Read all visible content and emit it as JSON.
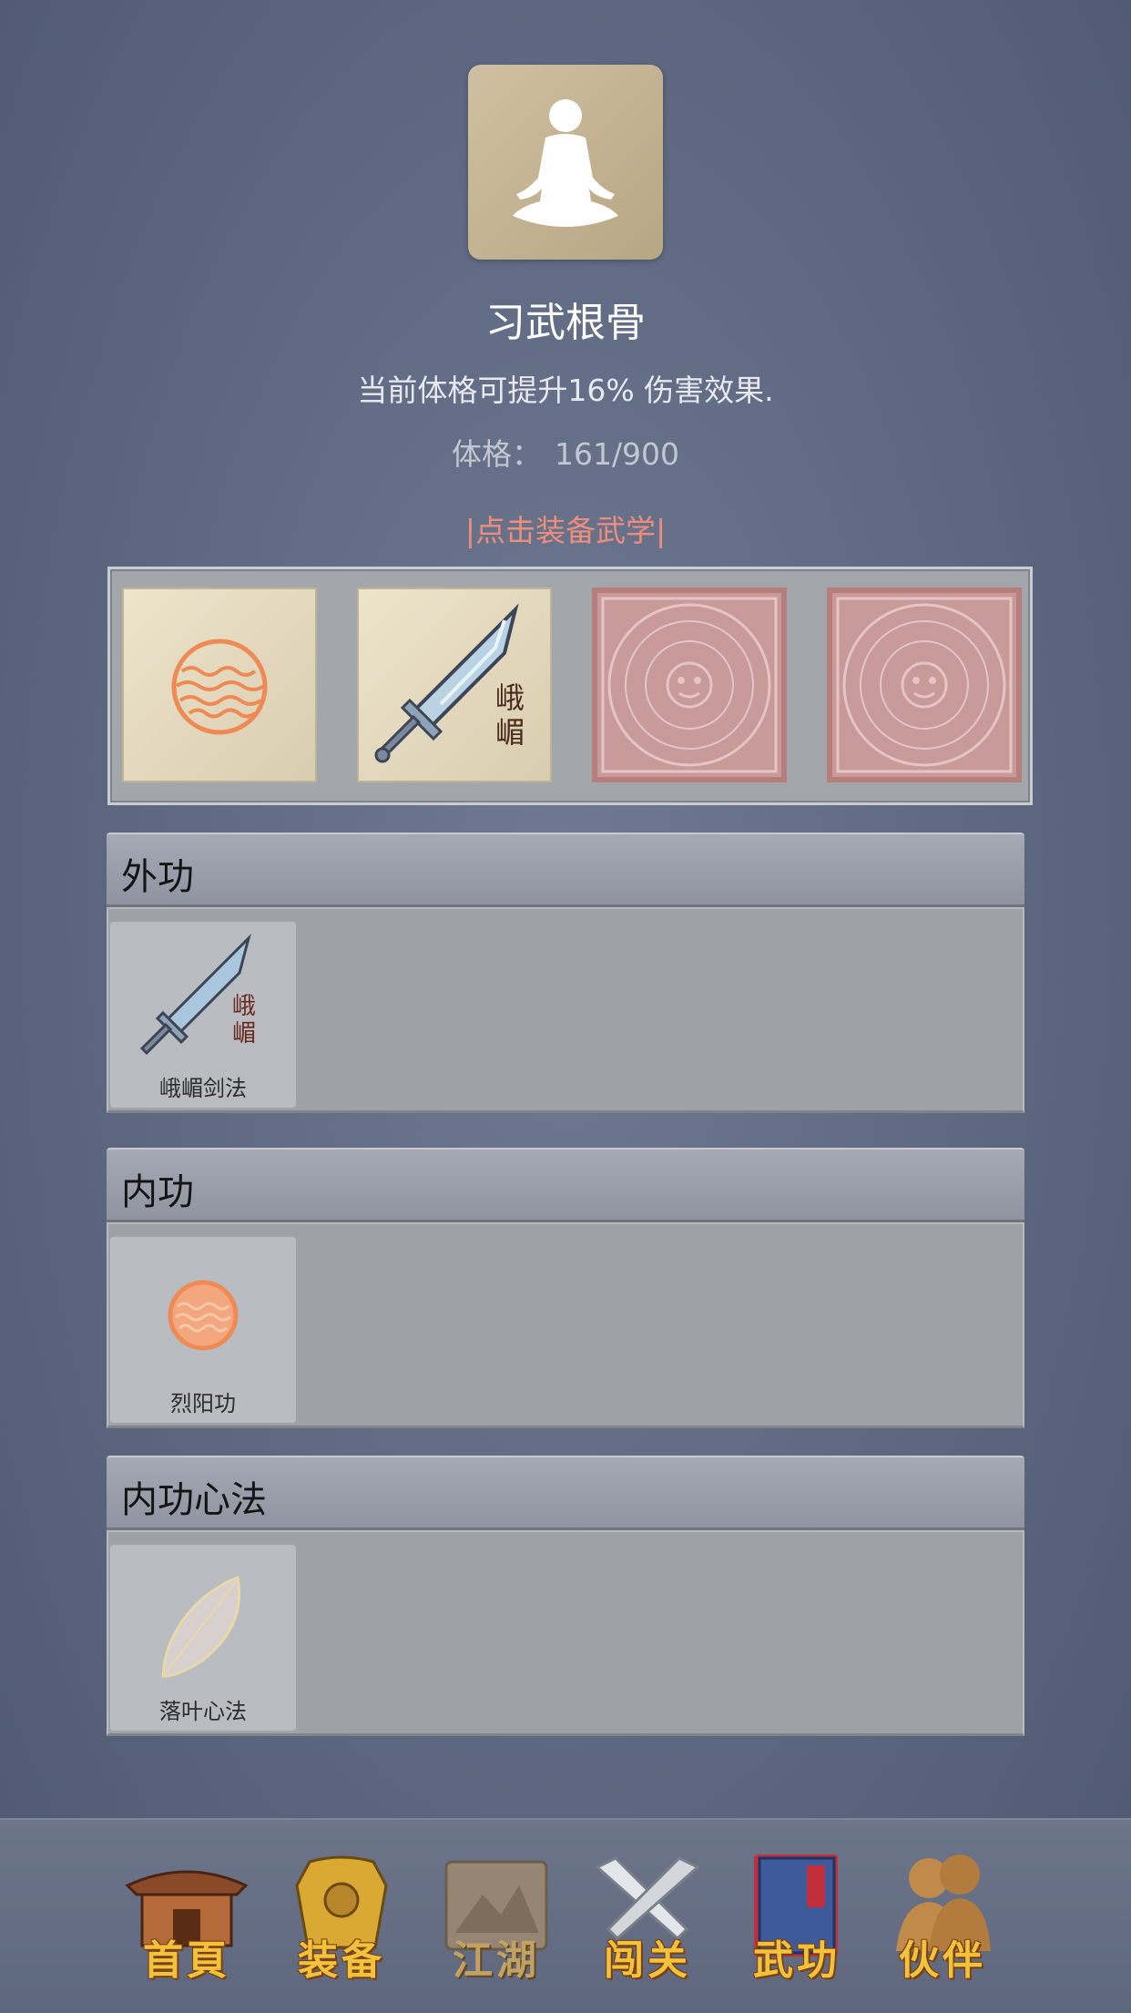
{
  "header": {
    "title": "习武根骨",
    "description": "当前体格可提升16% 伤害效果.",
    "stat_label": "体格：",
    "stat_value": "161/900",
    "equip_hint": "|点击装备武学|"
  },
  "equipped_slots": [
    {
      "icon": "sun-orb-icon",
      "state": "equipped"
    },
    {
      "icon": "emei-sword-icon",
      "state": "equipped",
      "glyph": "峨嵋"
    },
    {
      "icon": "aztec-calendar-icon",
      "state": "locked"
    },
    {
      "icon": "aztec-calendar-icon",
      "state": "locked"
    }
  ],
  "sections": [
    {
      "title": "外功",
      "items": [
        {
          "label": "峨嵋剑法",
          "glyph": "峨嵋",
          "icon": "emei-sword-icon"
        }
      ]
    },
    {
      "title": "内功",
      "items": [
        {
          "label": "烈阳功",
          "icon": "sun-orb-icon"
        }
      ]
    },
    {
      "title": "内功心法",
      "items": [
        {
          "label": "落叶心法",
          "icon": "leaf-icon"
        }
      ]
    }
  ],
  "nav": [
    {
      "label": "首頁",
      "icon": "house-icon"
    },
    {
      "label": "装备",
      "icon": "armor-icon"
    },
    {
      "label": "江湖",
      "icon": "scroll-map-icon"
    },
    {
      "label": "闯关",
      "icon": "crossed-swords-icon"
    },
    {
      "label": "武功",
      "icon": "book-icon",
      "active": true
    },
    {
      "label": "伙伴",
      "icon": "partners-icon"
    }
  ],
  "colors": {
    "background": "#5d6780",
    "hint": "#ef8d7c",
    "nav_label": "#f2c23a",
    "locked_slot": "#c99a9a"
  }
}
